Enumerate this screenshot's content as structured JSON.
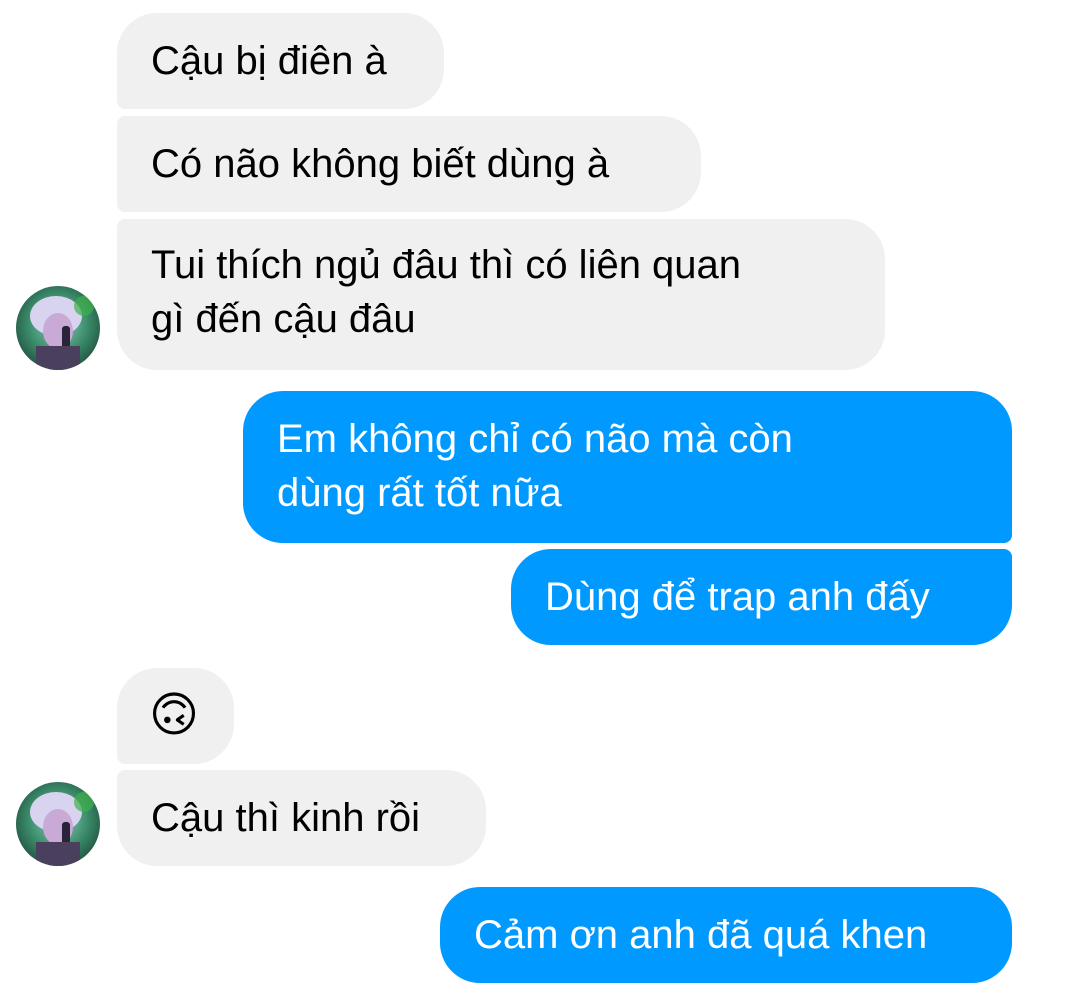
{
  "messages": [
    {
      "dir": "incoming",
      "text": "Cậu bị điên à"
    },
    {
      "dir": "incoming",
      "text": "Có não không biết dùng à"
    },
    {
      "dir": "incoming",
      "lines": [
        "Tui thích ngủ đâu thì có liên quan",
        "gì đến cậu đâu"
      ]
    },
    {
      "dir": "outgoing",
      "lines": [
        "Em không chỉ có não mà còn",
        "dùng rất tốt nữa"
      ]
    },
    {
      "dir": "outgoing",
      "text": "Dùng để trap anh đấy"
    },
    {
      "dir": "incoming",
      "emoji": "🙃",
      "icon": "upside-down-face-icon"
    },
    {
      "dir": "incoming",
      "text": "Cậu thì kinh rồi"
    },
    {
      "dir": "outgoing",
      "text": "Cảm ơn anh đã quá khen"
    }
  ],
  "colors": {
    "incoming_bg": "#f1f0f0",
    "outgoing_bg": "#0099ff",
    "outgoing_text": "#ffffff",
    "incoming_text": "#000000"
  }
}
